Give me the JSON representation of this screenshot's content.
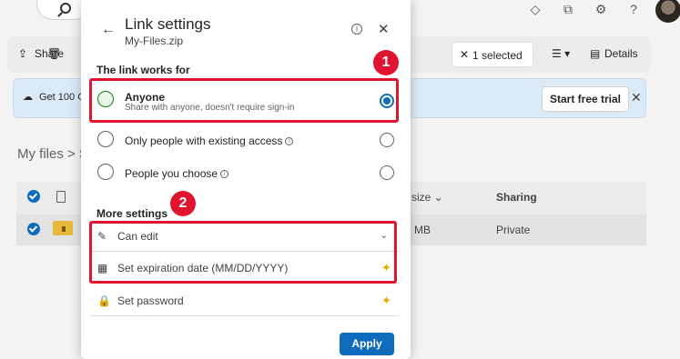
{
  "background": {
    "toolbar": {
      "share_label": "Share",
      "selected_label": "1 selected",
      "details_label": "Details"
    },
    "banner": {
      "text": "Get 100 GB",
      "trial_button": "Start free trial"
    },
    "breadcrumb": "My files  >  S",
    "list": {
      "size_header": "size",
      "sharing_header": "Sharing",
      "row_size": "MB",
      "row_sharing": "Private"
    }
  },
  "dialog": {
    "title": "Link settings",
    "subtitle": "My-Files.zip",
    "link_section_title": "The link works for",
    "options": [
      {
        "label": "Anyone",
        "description": "Share with anyone, doesn't require sign-in",
        "selected": true
      },
      {
        "label": "Only people with existing access",
        "selected": false
      },
      {
        "label": "People you choose",
        "selected": false
      }
    ],
    "more_settings_title": "More settings",
    "settings": {
      "permission": "Can edit",
      "expiration_placeholder": "Set expiration date (MM/DD/YYYY)",
      "password_placeholder": "Set password"
    },
    "apply_label": "Apply"
  },
  "callouts": {
    "badge1": "1",
    "badge2": "2",
    "color": "#e0142f"
  },
  "accent_color": "#0f6cbd"
}
